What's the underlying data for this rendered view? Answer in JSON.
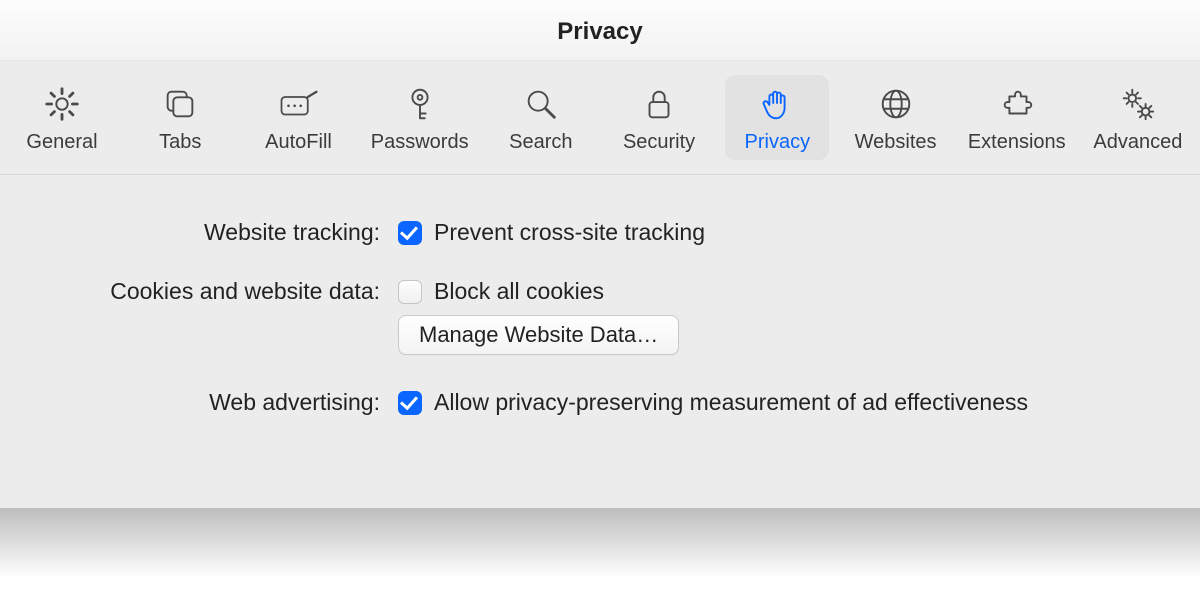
{
  "title": "Privacy",
  "tabs": [
    {
      "label": "General"
    },
    {
      "label": "Tabs"
    },
    {
      "label": "AutoFill"
    },
    {
      "label": "Passwords"
    },
    {
      "label": "Search"
    },
    {
      "label": "Security"
    },
    {
      "label": "Privacy"
    },
    {
      "label": "Websites"
    },
    {
      "label": "Extensions"
    },
    {
      "label": "Advanced"
    }
  ],
  "rows": {
    "tracking": {
      "label": "Website tracking:",
      "checkbox": "Prevent cross-site tracking"
    },
    "cookies": {
      "label": "Cookies and website data:",
      "checkbox": "Block all cookies",
      "button": "Manage Website Data…"
    },
    "ads": {
      "label": "Web advertising:",
      "checkbox": "Allow privacy-preserving measurement of ad effectiveness"
    }
  }
}
